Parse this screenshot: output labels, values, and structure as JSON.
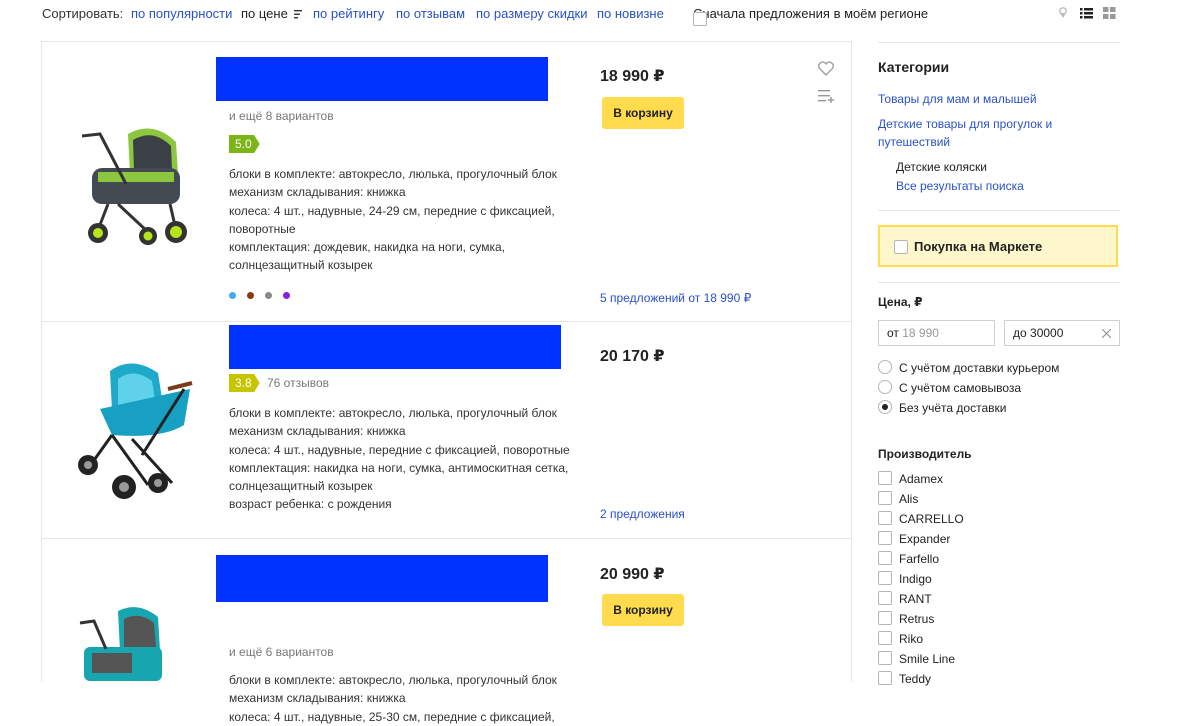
{
  "sort": {
    "label": "Сортировать:",
    "options": [
      "по популярности",
      "по цене",
      "по рейтингу",
      "по отзывам",
      "по размеру скидки",
      "по новизне"
    ],
    "active": "по цене",
    "region_checkbox": "Сначала предложения в моём регионе"
  },
  "products": [
    {
      "variants": "и ещё 8 вариантов",
      "rating": "5.0",
      "specs": [
        "блоки в комплекте: автокресло, люлька, прогулочный блок",
        "механизм складывания: книжка",
        "колеса: 4 шт., надувные, 24-29 см, передние с фиксацией,",
        "поворотные",
        "комплектация: дождевик, накидка на ноги, сумка,",
        "солнцезащитный козырек"
      ],
      "colors": [
        "#3fa9f5",
        "#8b3a0f",
        "#8a8a8a",
        "#8a1ee0"
      ],
      "price": "18 990 ₽",
      "cart_label": "В корзину",
      "offers": "5 предложений от 18 990 ₽"
    },
    {
      "rating": "3.8",
      "reviews": "76 отзывов",
      "specs": [
        "блоки в комплекте: автокресло, люлька, прогулочный блок",
        "механизм складывания: книжка",
        "колеса: 4 шт., надувные, передние с фиксацией, поворотные",
        "комплектация: накидка на ноги, сумка, антимоскитная сетка,",
        "солнцезащитный козырек",
        "возраст ребенка: с рождения"
      ],
      "price": "20 170 ₽",
      "offers": "2 предложения"
    },
    {
      "variants": "и ещё 6 вариантов",
      "specs": [
        "блоки в комплекте: автокресло, люлька, прогулочный блок",
        "механизм складывания: книжка",
        "колеса: 4 шт., надувные, 25-30 см, передние с фиксацией,"
      ],
      "price": "20 990 ₽",
      "cart_label": "В корзину"
    }
  ],
  "sidebar": {
    "categories_title": "Категории",
    "cat1": "Товары для мам и малышей",
    "cat2": "Детские товары для прогулок и путешествий",
    "current": "Детские коляски",
    "all_results": "Все результаты поиска",
    "market_purchase": "Покупка на Маркете",
    "price_title": "Цена, ₽",
    "price_from_label": "от",
    "price_from_placeholder": "18 990",
    "price_to_label": "до",
    "price_to_value": "30000",
    "delivery_options": [
      "С учётом доставки курьером",
      "С учётом самовывоза",
      "Без учёта доставки"
    ],
    "delivery_selected": 2,
    "manufacturer_title": "Производитель",
    "manufacturers": [
      "Adamex",
      "Alis",
      "CARRELLO",
      "Expander",
      "Farfello",
      "Indigo",
      "RANT",
      "Retrus",
      "Riko",
      "Smile Line",
      "Teddy"
    ]
  },
  "colors": {
    "link": "#2a50c8",
    "button": "#ffdb4d",
    "title_placeholder": "#0033ff",
    "rating_green": "#7cb518",
    "rating_yellow": "#c7c400"
  }
}
